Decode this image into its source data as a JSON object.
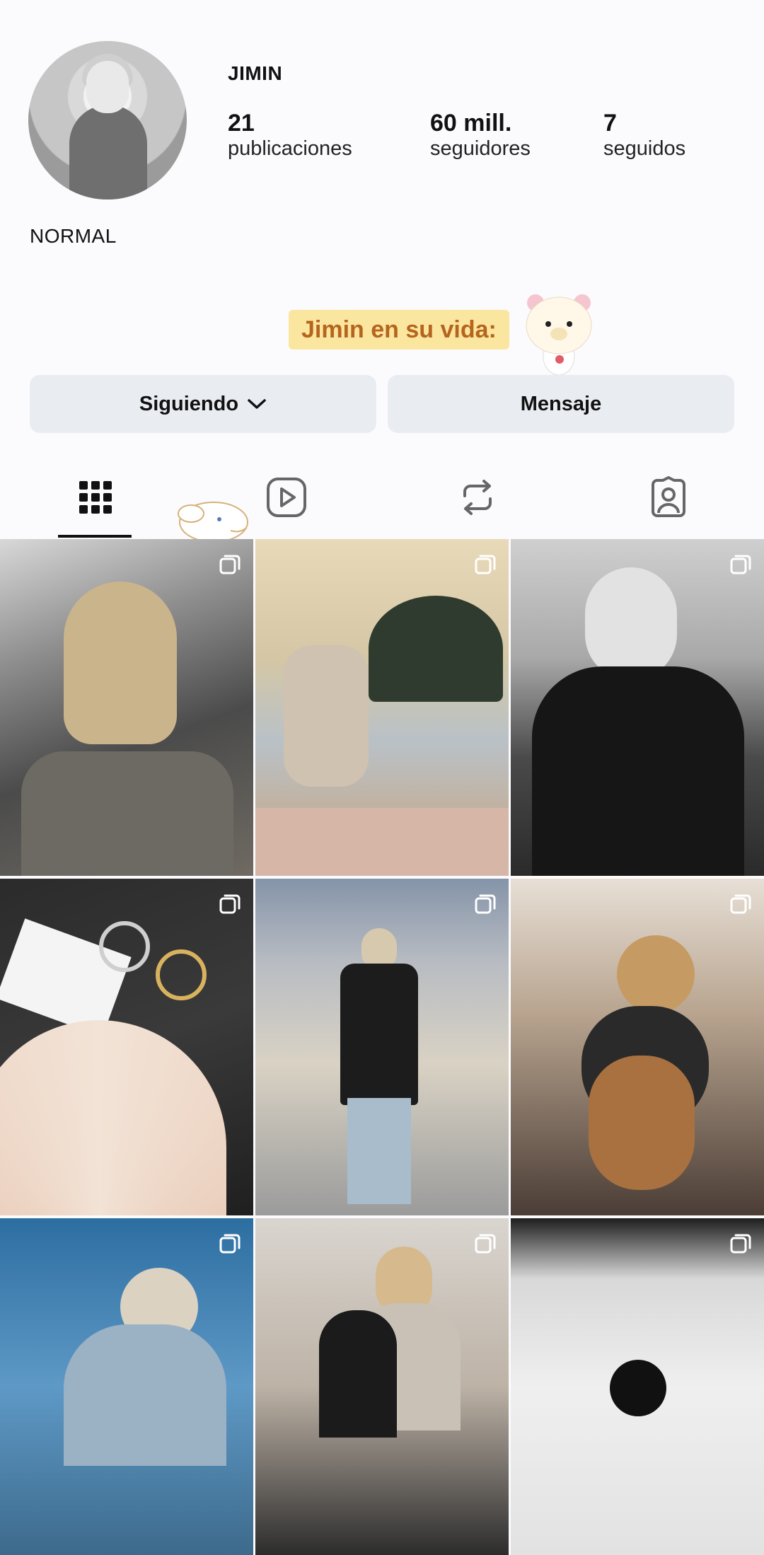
{
  "profile": {
    "username": "JIMIN",
    "bio": "NORMAL",
    "stats": [
      {
        "value": "21",
        "label": "publicaciones"
      },
      {
        "value": "60 mill.",
        "label": "seguidores"
      },
      {
        "value": "7",
        "label": "seguidos"
      }
    ]
  },
  "highlight": {
    "label": "Jimin en su vida:"
  },
  "buttons": {
    "following": "Siguiendo",
    "message": "Mensaje"
  },
  "tabs": [
    {
      "name": "grid-icon",
      "active": true
    },
    {
      "name": "reels-icon",
      "active": false
    },
    {
      "name": "reposts-icon",
      "active": false
    },
    {
      "name": "tagged-icon",
      "active": false
    }
  ],
  "colors": {
    "highlight_bg": "#fbe6a0",
    "highlight_text": "#b5651d",
    "button_bg": "#e9edf2"
  },
  "posts": [
    {
      "icon": "carousel-icon",
      "desc": "photo"
    },
    {
      "icon": "carousel-icon",
      "desc": "photo"
    },
    {
      "icon": "carousel-icon",
      "desc": "photo"
    },
    {
      "icon": "carousel-icon",
      "desc": "photo"
    },
    {
      "icon": "carousel-icon",
      "desc": "photo"
    },
    {
      "icon": "carousel-icon",
      "desc": "photo"
    },
    {
      "icon": "carousel-icon",
      "desc": "photo"
    },
    {
      "icon": "carousel-icon",
      "desc": "photo"
    },
    {
      "icon": "carousel-icon",
      "desc": "photo"
    }
  ]
}
